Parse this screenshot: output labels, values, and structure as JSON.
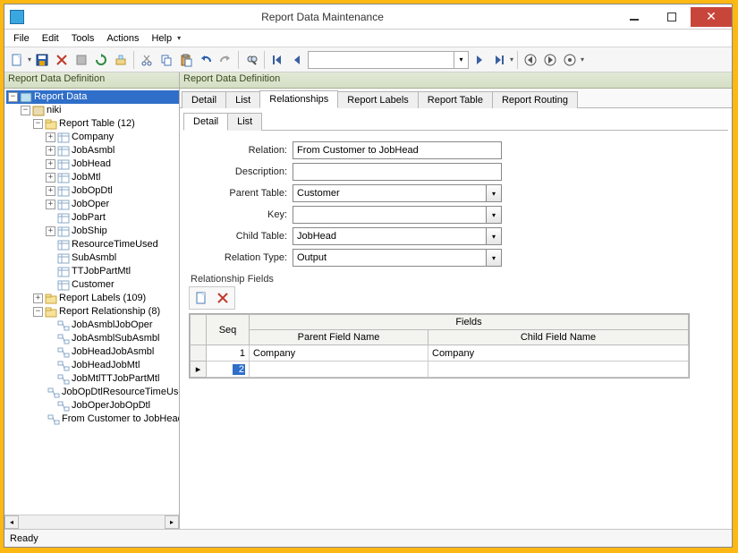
{
  "window": {
    "title": "Report Data Maintenance"
  },
  "menu": {
    "items": [
      "File",
      "Edit",
      "Tools",
      "Actions",
      "Help"
    ]
  },
  "panes": {
    "left_header": "Report Data Definition",
    "right_header": "Report Data Definition"
  },
  "tree": {
    "root": "Report Data",
    "niki": "niki",
    "report_table": "Report Table (12)",
    "rt_children": [
      "Company",
      "JobAsmbl",
      "JobHead",
      "JobMtl",
      "JobOpDtl",
      "JobOper",
      "JobPart",
      "JobShip",
      "ResourceTimeUsed",
      "SubAsmbl",
      "TTJobPartMtl",
      "Customer"
    ],
    "report_labels": "Report Labels (109)",
    "report_rel": "Report Relationship (8)",
    "rr_children": [
      "JobAsmblJobOper",
      "JobAsmblSubAsmbl",
      "JobHeadJobAsmbl",
      "JobHeadJobMtl",
      "JobMtlTTJobPartMtl",
      "JobOpDtlResourceTimeUse",
      "JobOperJobOpDtl",
      "From Customer to JobHead"
    ]
  },
  "tabs": {
    "main": [
      "Detail",
      "List",
      "Relationships",
      "Report Labels",
      "Report Table",
      "Report Routing"
    ],
    "main_active": 2,
    "sub": [
      "Detail",
      "List"
    ],
    "sub_active": 0
  },
  "form": {
    "relation_label": "Relation:",
    "relation_value": "From Customer to JobHead",
    "description_label": "Description:",
    "description_value": "",
    "parent_table_label": "Parent Table:",
    "parent_table_value": "Customer",
    "key_label": "Key:",
    "key_value": "",
    "child_table_label": "Child Table:",
    "child_table_value": "JobHead",
    "relation_type_label": "Relation Type:",
    "relation_type_value": "Output"
  },
  "rel_fields": {
    "section": "Relationship Fields",
    "header_group": "Fields",
    "cols": [
      "Seq",
      "Parent Field Name",
      "Child Field Name"
    ],
    "rows": [
      {
        "seq": "1",
        "parent": "Company",
        "child": "Company"
      },
      {
        "seq": "2",
        "parent": "",
        "child": "",
        "editing": true
      }
    ]
  },
  "status": {
    "text": "Ready"
  }
}
